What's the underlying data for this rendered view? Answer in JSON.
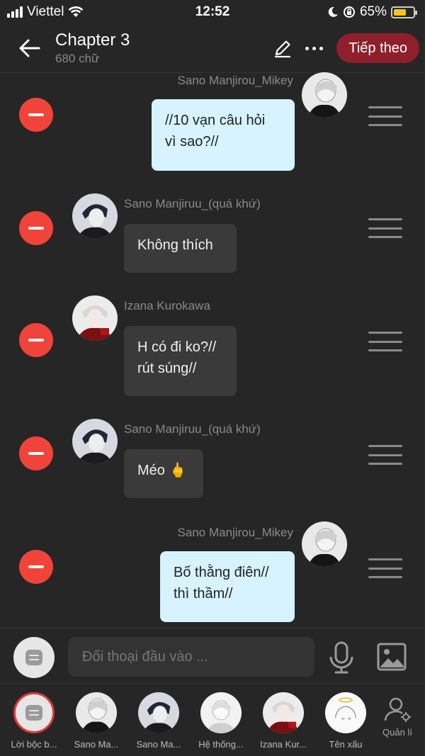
{
  "status_bar": {
    "carrier": "Viettel",
    "time": "12:52",
    "battery": "65%",
    "battery_level": 0.65
  },
  "header": {
    "title": "Chapter 3",
    "subtitle": "680 chữ",
    "next_label": "Tiếp theo"
  },
  "messages": [
    {
      "sender": "Sano Manjirou_Mikey",
      "text_lines": [
        "//10 vạn câu hỏi",
        "vì sao?//"
      ],
      "side": "right"
    },
    {
      "sender": "Sano Manjiruu_(quá khứ)",
      "text_lines": [
        "Không thích"
      ],
      "side": "left"
    },
    {
      "sender": "Izana Kurokawa",
      "text_lines": [
        "H có đi ko?//",
        "rút súng//"
      ],
      "side": "left"
    },
    {
      "sender": "Sano Manjiruu_(quá khứ)",
      "text_lines": [
        "Méo 🖕"
      ],
      "side": "left"
    },
    {
      "sender": "Sano Manjirou_Mikey",
      "text_lines": [
        "Bố thằng điên//",
        "thì thầm//"
      ],
      "side": "right"
    }
  ],
  "input": {
    "placeholder": "Đối thoại đầu vào ..."
  },
  "characters": [
    {
      "label": "Lời bộc b..."
    },
    {
      "label": "Sano Ma..."
    },
    {
      "label": "Sano Ma..."
    },
    {
      "label": "Hệ thống..."
    },
    {
      "label": "Izana Kur..."
    },
    {
      "label": "Tên xấu"
    }
  ],
  "manage_label": "Quản lí",
  "colors": {
    "background": "#262626",
    "accent_red": "#f0443a",
    "next_button": "#8f1f2a",
    "right_bubble": "#d6f3ff",
    "left_bubble": "#3a3a3a"
  }
}
